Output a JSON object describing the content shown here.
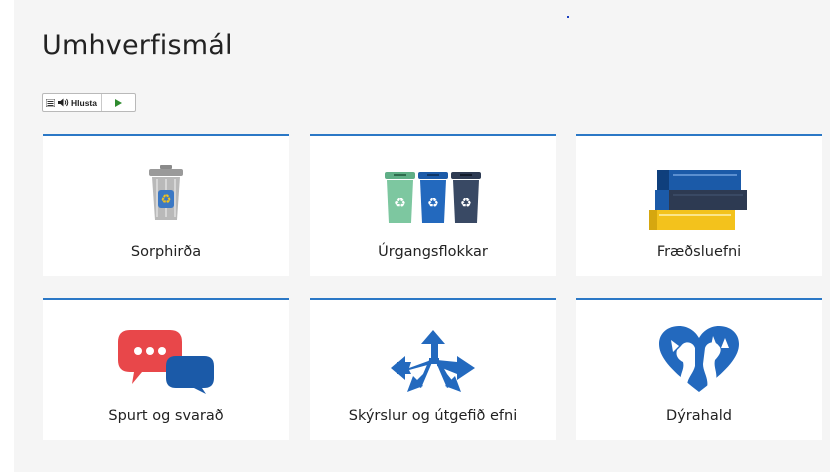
{
  "page": {
    "title": "Umhverfismál"
  },
  "toolbar": {
    "listen_label": "Hlusta"
  },
  "cards": [
    {
      "label": "Sorphirða",
      "icon": "trash-can-icon"
    },
    {
      "label": "Úrgangsflokkar",
      "icon": "recycling-bins-icon"
    },
    {
      "label": "Fræðsluefni",
      "icon": "books-icon"
    },
    {
      "label": "Spurt og svarað",
      "icon": "speech-bubbles-icon"
    },
    {
      "label": "Skýrslur og útgefið efni",
      "icon": "directional-arrows-icon"
    },
    {
      "label": "Dýrahald",
      "icon": "pets-heart-icon"
    }
  ],
  "colors": {
    "accent": "#2b78c6",
    "background": "#f5f5f5",
    "card": "#ffffff"
  }
}
